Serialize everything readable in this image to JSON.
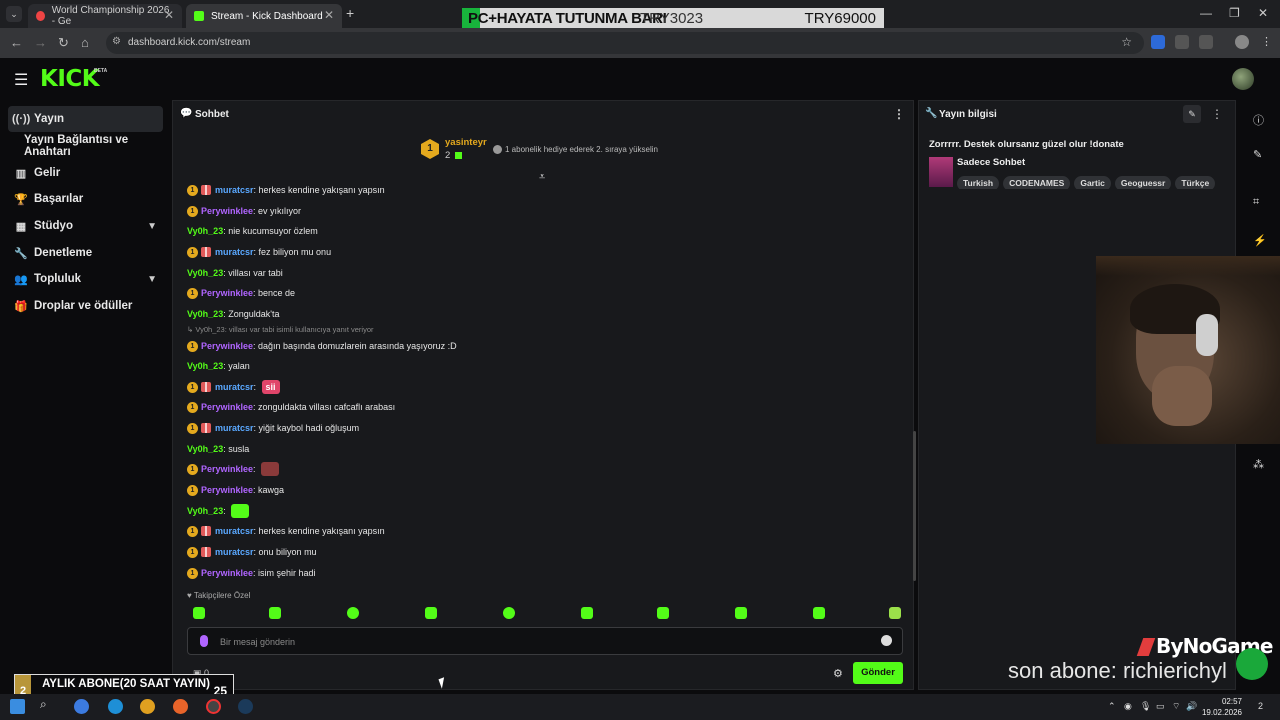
{
  "browser": {
    "tabs": [
      {
        "label": "World Championship 2026 - Ge",
        "active": false
      },
      {
        "label": "Stream - Kick Dashboard",
        "active": true
      }
    ],
    "url": "dashboard.kick.com/stream"
  },
  "overlay_banner": {
    "left_text": "PC+HAYATA TUTUNMA BARI",
    "mid_text": "TRY3023",
    "right_text": "TRY69000"
  },
  "kick": {
    "logo": "KICK",
    "beta": "BETA"
  },
  "sidebar": {
    "items": [
      {
        "label": "Yayın",
        "icon": "broadcast-icon",
        "active": true
      },
      {
        "label": "Yayın Bağlantısı ve Anahtarı",
        "icon": "",
        "active": false
      },
      {
        "label": "Gelir",
        "icon": "chart-icon",
        "active": false
      },
      {
        "label": "Başarılar",
        "icon": "trophy-icon",
        "active": false
      },
      {
        "label": "Stüdyo",
        "icon": "grid-icon",
        "active": false,
        "expandable": true
      },
      {
        "label": "Denetleme",
        "icon": "wrench-icon",
        "active": false
      },
      {
        "label": "Topluluk",
        "icon": "people-icon",
        "active": false,
        "expandable": true
      },
      {
        "label": "Droplar ve ödüller",
        "icon": "gift-icon",
        "active": false
      }
    ]
  },
  "chat": {
    "title": "Sohbet",
    "pinned": {
      "rank": "1",
      "user": "yasinteyr",
      "count": "2",
      "gift_text": "1 abonelik hediye ederek 2. sıraya yükselin"
    },
    "reply_context": "Vy0h_23: villası var tabi isimli kullanıcıya yanıt veriyor",
    "messages": [
      {
        "user": "muratcsr",
        "cls": "u-mur",
        "coin": true,
        "gift": true,
        "text": ": herkes kendine yakışanı yapsın"
      },
      {
        "user": "Perywinklee",
        "cls": "u-per",
        "coin": true,
        "gift": false,
        "text": ": ev yıkılıyor"
      },
      {
        "user": "Vy0h_23",
        "cls": "u-vy",
        "coin": false,
        "gift": false,
        "text": ": nie kucumsuyor özlem"
      },
      {
        "user": "muratcsr",
        "cls": "u-mur",
        "coin": true,
        "gift": true,
        "text": ": fez biliyon mu onu"
      },
      {
        "user": "Vy0h_23",
        "cls": "u-vy",
        "coin": false,
        "gift": false,
        "text": ": villası var tabi"
      },
      {
        "user": "Perywinklee",
        "cls": "u-per",
        "coin": true,
        "gift": false,
        "text": ": bence de"
      },
      {
        "user": "Vy0h_23",
        "cls": "u-vy",
        "coin": false,
        "gift": false,
        "text": ": Zonguldak'ta"
      },
      {
        "user": "Perywinklee",
        "cls": "u-per",
        "coin": true,
        "gift": false,
        "text": ": dağın başında domuzlarein arasında yaşıyoruz :D"
      },
      {
        "user": "Vy0h_23",
        "cls": "u-vy",
        "coin": false,
        "gift": false,
        "text": ": yalan"
      },
      {
        "user": "muratcsr",
        "cls": "u-mur",
        "coin": true,
        "gift": true,
        "text": ": ",
        "emote": "#e0456a",
        "emote_text": "sii"
      },
      {
        "user": "Perywinklee",
        "cls": "u-per",
        "coin": true,
        "gift": false,
        "text": ": zonguldakta villası cafcaflı arabası"
      },
      {
        "user": "muratcsr",
        "cls": "u-mur",
        "coin": true,
        "gift": true,
        "text": ": yiğit kaybol hadi oğluşum"
      },
      {
        "user": "Vy0h_23",
        "cls": "u-vy",
        "coin": false,
        "gift": false,
        "text": ": susla"
      },
      {
        "user": "Perywinklee",
        "cls": "u-per",
        "coin": true,
        "gift": false,
        "text": ": ",
        "emote": "#8a3a3a",
        "emote_text": ""
      },
      {
        "user": "Perywinklee",
        "cls": "u-per",
        "coin": true,
        "gift": false,
        "text": ": kawga"
      },
      {
        "user": "Vy0h_23",
        "cls": "u-vy",
        "coin": false,
        "gift": false,
        "text": ": ",
        "emote": "#53fc18",
        "emote_text": ""
      },
      {
        "user": "muratcsr",
        "cls": "u-mur",
        "coin": true,
        "gift": true,
        "text": ": herkes kendine yakışanı yapsın"
      },
      {
        "user": "muratcsr",
        "cls": "u-mur",
        "coin": true,
        "gift": true,
        "text": ": onu biliyon mu"
      },
      {
        "user": "Perywinklee",
        "cls": "u-per",
        "coin": true,
        "gift": false,
        "text": ": isim şehir hadi"
      }
    ],
    "followers_only": "Takipçilere Özel",
    "input_placeholder": "Bir mesaj gönderin",
    "points": "0",
    "send_label": "Gönder"
  },
  "stream_info": {
    "title": "Yayın bilgisi",
    "stream_title": "Zorrrrr. Destek olursanız güzel olur !donate",
    "category": "Sadece Sohbet",
    "tags": [
      "Turkish",
      "CODENAMES",
      "Gartic",
      "Geoguessr",
      "Türkçe"
    ]
  },
  "overlays": {
    "brand": "ByNoGame",
    "last_sub": "son abone: richierichyl",
    "goal_left": "2",
    "goal_text": "AYLIK ABONE(20 SAAT YAYIN)",
    "goal_right": "25"
  },
  "taskbar": {
    "time": "02:57",
    "date": "19.02.2026",
    "notif": "2"
  }
}
